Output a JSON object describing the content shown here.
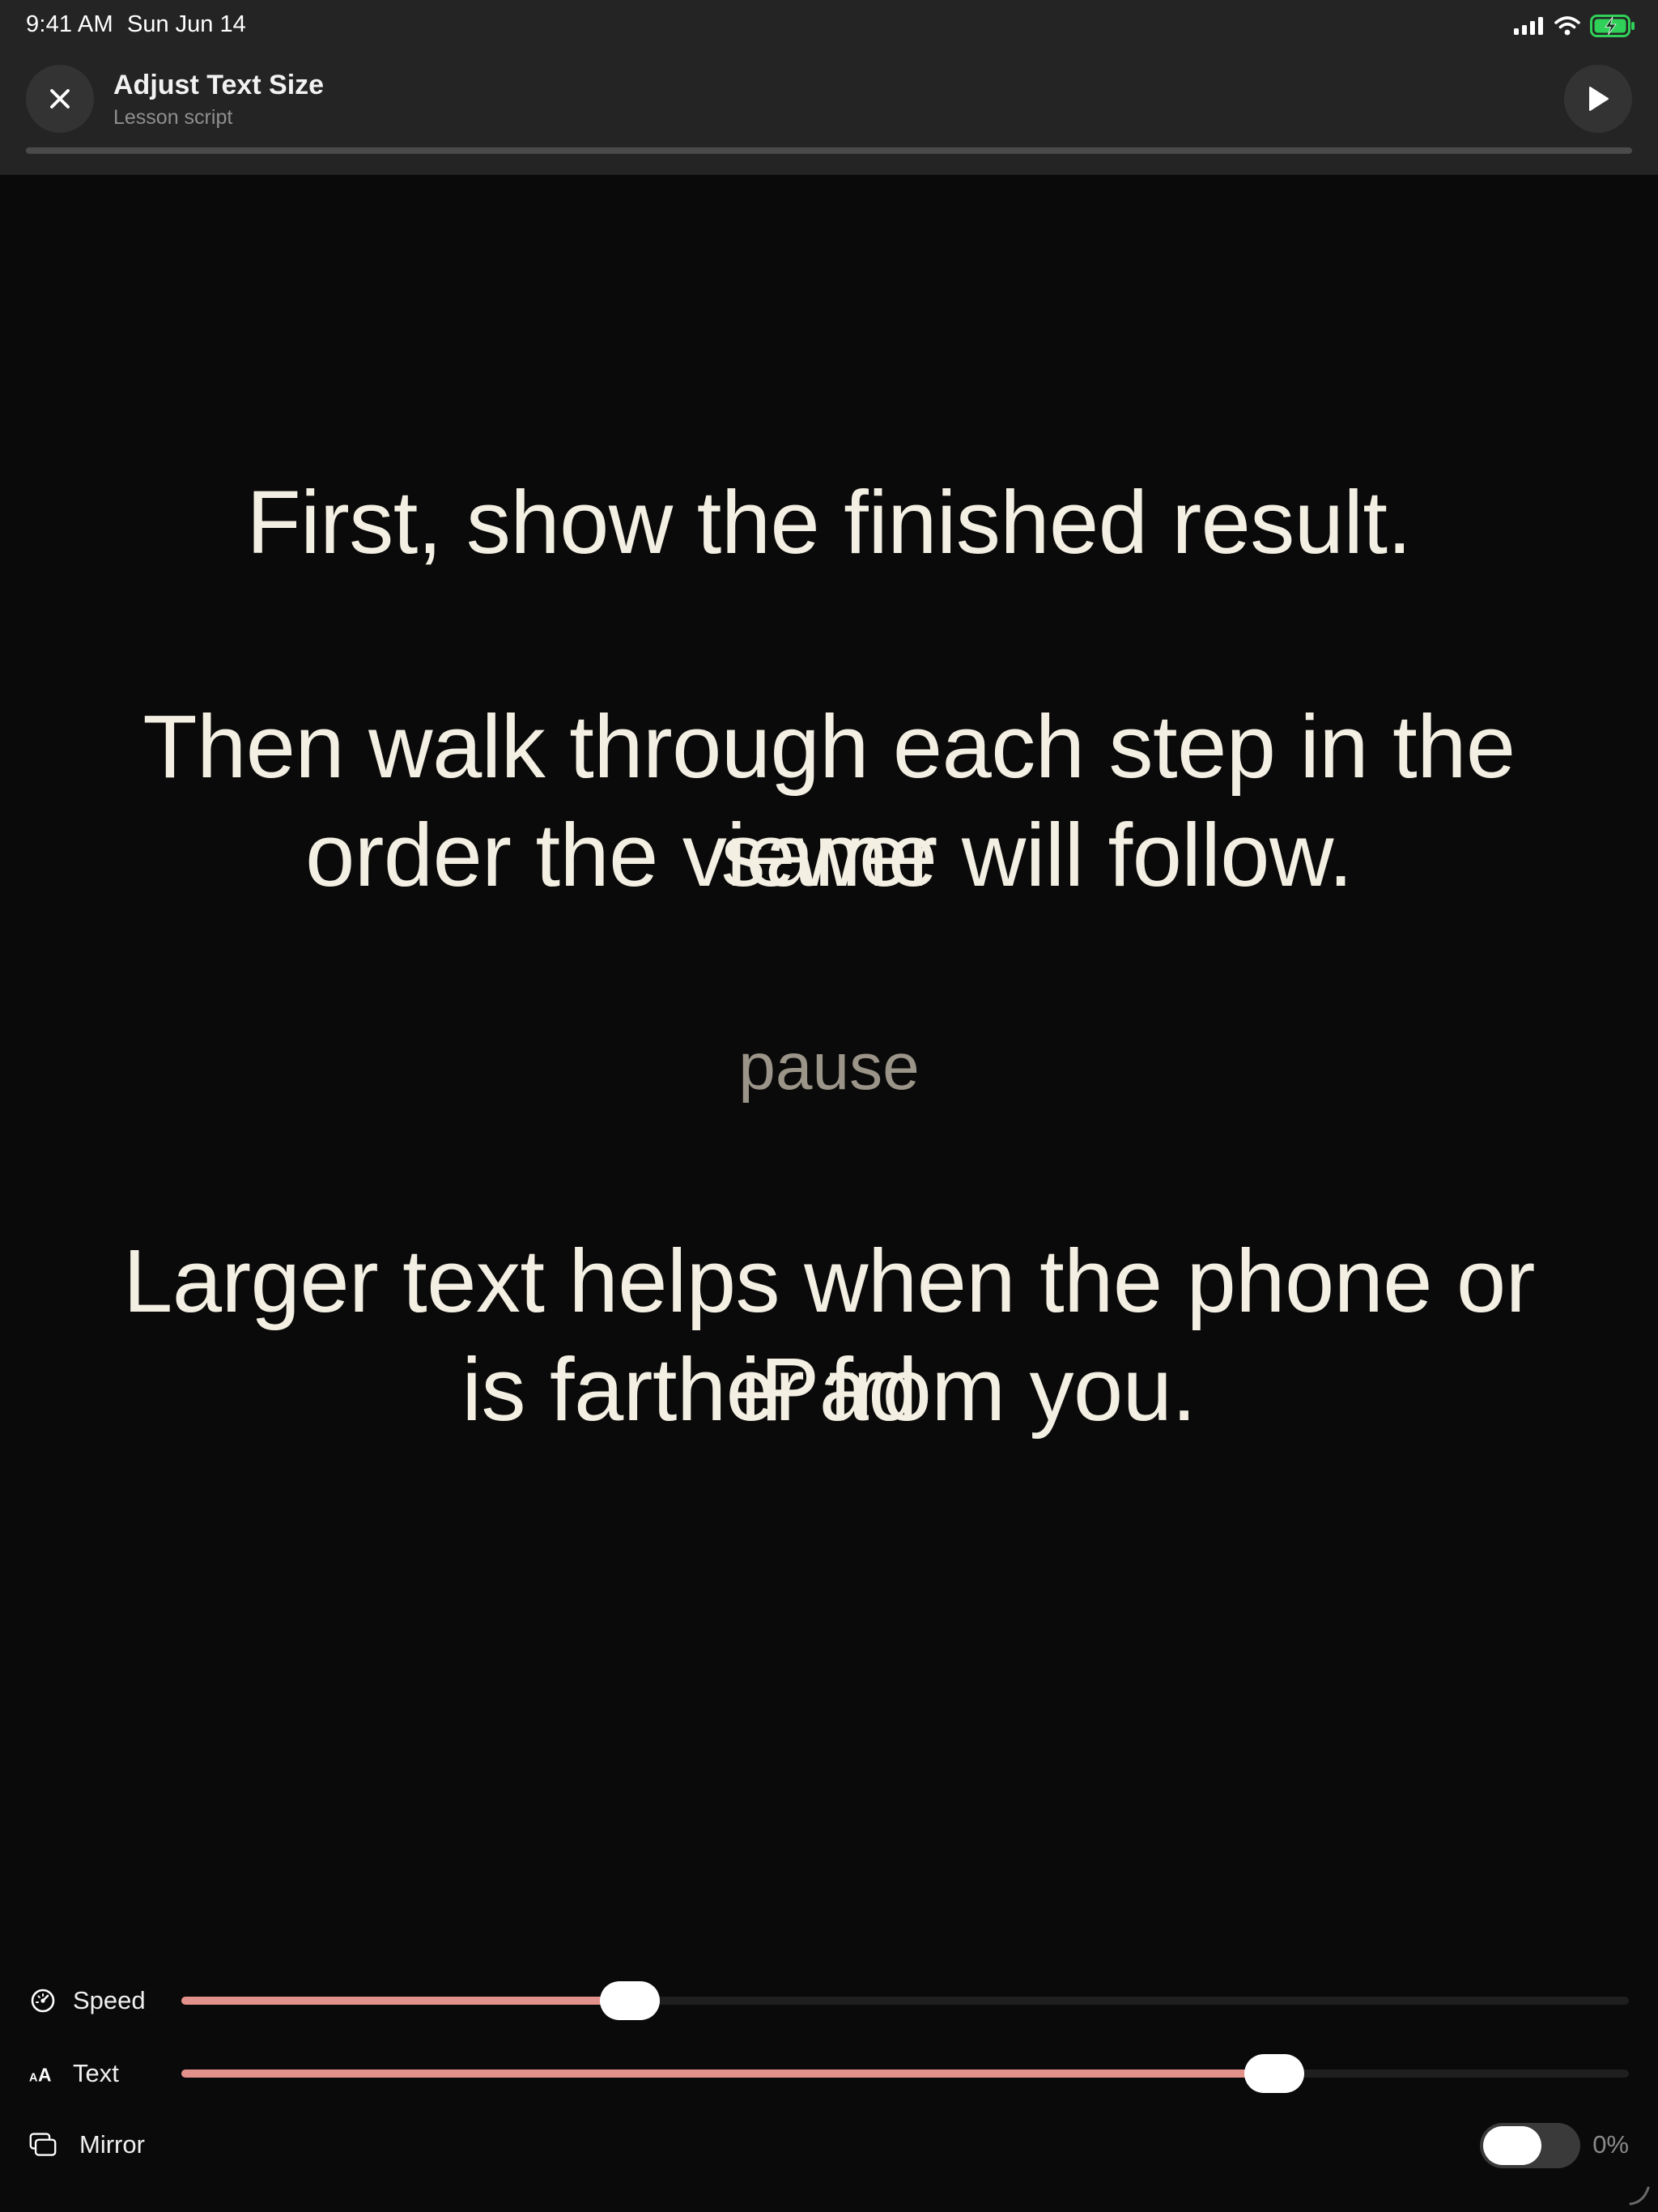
{
  "status_bar": {
    "time": "9:41 AM",
    "date": "Sun Jun 14",
    "icons": [
      "cellular-signal-icon",
      "wifi-icon",
      "battery-charging-icon"
    ],
    "battery_color": "#30d158"
  },
  "header": {
    "title": "Adjust Text Size",
    "subtitle": "Lesson script",
    "close_icon": "close-icon",
    "play_icon": "play-icon",
    "progress": 0
  },
  "script": {
    "paragraph_1": "First, show the finished result.",
    "paragraph_2_line_1": "Then walk through each step in the same",
    "paragraph_2_line_2": "order the viewer will follow.",
    "pause_marker": "pause",
    "paragraph_3_line_1": "Larger text helps when the phone or iPad",
    "paragraph_3_line_2": "is farther from you."
  },
  "controls": {
    "speed": {
      "label": "Speed",
      "icon": "speedometer-icon",
      "value": 0.31
    },
    "text": {
      "label": "Text",
      "icon": "text-size-icon",
      "value": 0.755
    },
    "mirror": {
      "label": "Mirror",
      "icon": "mirror-icon",
      "enabled": false,
      "value_text": "0%"
    }
  },
  "colors": {
    "accent": "#e3928b",
    "script_text": "#f3efe3",
    "pause_text": "#9b9488",
    "background": "#0a0a0a",
    "chrome": "#242424"
  }
}
